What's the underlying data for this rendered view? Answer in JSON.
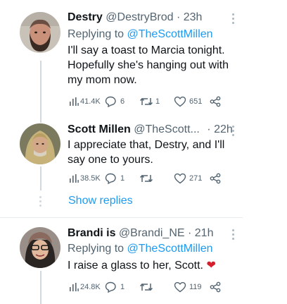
{
  "tweets": [
    {
      "name": "Destry",
      "handle": "@DestryBrod",
      "time": "· 23h",
      "replying_prefix": "Replying to",
      "replying_to": "@TheScottMillen",
      "text": "I'll say a toast to Marcia tonight. Hopefully she's hanging out with my mom now.",
      "views": "41.4K",
      "replies": "6",
      "retweets": "1",
      "likes": "651"
    },
    {
      "name": "Scott Millen",
      "handle": "@TheScott...",
      "time": "· 22h",
      "text": "I appreciate that, Destry, and I'll say one to yours.",
      "views": "38.5K",
      "replies": "1",
      "retweets": "",
      "likes": "271"
    },
    {
      "name": "Brandi is",
      "handle": "@Brandi_NE",
      "time": "· 21h",
      "replying_prefix": "Replying to",
      "replying_to": "@TheScottMillen",
      "text": "I raise a glass to her, Scott.",
      "emoji": "❤",
      "views": "24.8K",
      "replies": "1",
      "retweets": "",
      "likes": "119"
    }
  ],
  "show_replies_label": "Show replies",
  "colors": {
    "accent": "#1d9bf0",
    "secondary_text": "#536471",
    "thread_line": "#cfd9de",
    "heart": "#d61f2b"
  }
}
